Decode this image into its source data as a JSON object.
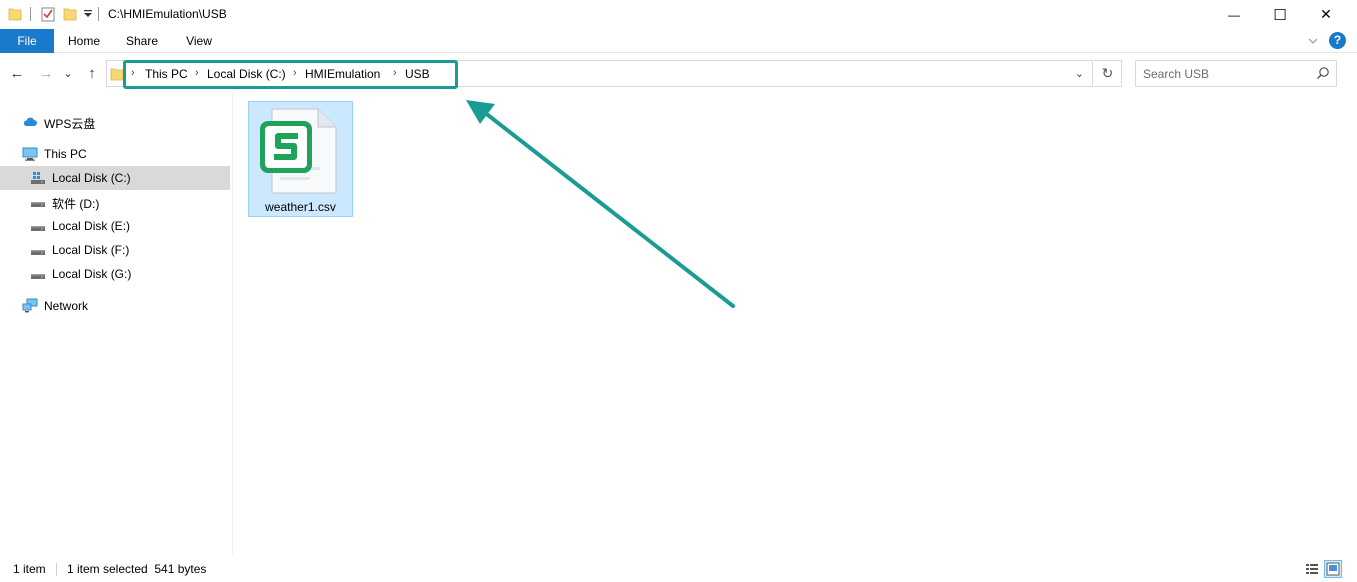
{
  "window": {
    "title": "C:\\HMIEmulation\\USB",
    "minimize_glyph": "—",
    "maximize_glyph": "☐",
    "close_glyph": "✕"
  },
  "ribbon": {
    "tabs": [
      {
        "label": "File"
      },
      {
        "label": "Home"
      },
      {
        "label": "Share"
      },
      {
        "label": "View"
      }
    ],
    "help_glyph": "?"
  },
  "navigation": {
    "back_glyph": "←",
    "forward_glyph": "→",
    "recent_glyph": "⌄",
    "up_glyph": "↑",
    "breadcrumbs": [
      {
        "label": "This PC"
      },
      {
        "label": "Local Disk (C:)"
      },
      {
        "label": "HMIEmulation"
      },
      {
        "label": "USB"
      }
    ],
    "separator_glyph": "›",
    "dropdown_glyph": "⌄",
    "refresh_glyph": "↻",
    "search_placeholder": "Search USB"
  },
  "sidebar": {
    "items": [
      {
        "label": "WPS云盘",
        "icon": "cloud-icon"
      },
      {
        "label": "This PC",
        "icon": "computer-icon"
      },
      {
        "label": "Local Disk (C:)",
        "icon": "windows-drive-icon",
        "selected": true
      },
      {
        "label": "软件 (D:)",
        "icon": "drive-icon"
      },
      {
        "label": "Local Disk (E:)",
        "icon": "drive-icon"
      },
      {
        "label": "Local Disk (F:)",
        "icon": "drive-icon"
      },
      {
        "label": "Local Disk (G:)",
        "icon": "drive-icon"
      },
      {
        "label": "Network",
        "icon": "network-icon"
      }
    ]
  },
  "files": [
    {
      "name": "weather1.csv",
      "icon": "wps-spreadsheet-icon",
      "selected": true
    }
  ],
  "status": {
    "item_count": "1 item",
    "selection": "1 item selected  541 bytes"
  },
  "colors": {
    "accent": "#1979ca",
    "annotation": "#1a9c94",
    "selection": "#cce8ff",
    "wps_green": "#1fa25a"
  }
}
